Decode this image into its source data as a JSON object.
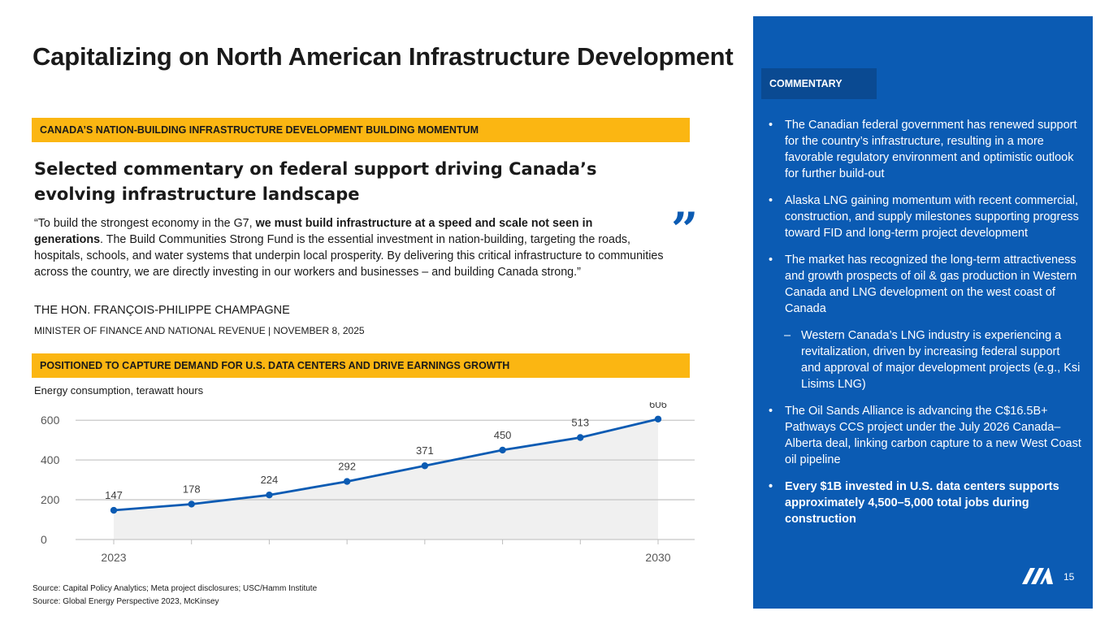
{
  "title": "Capitalizing on North American Infrastructure Development",
  "banner1": "CANADA’S NATION-BUILDING INFRASTRUCTURE DEVELOPMENT BUILDING MOMENTUM",
  "subhead": "Selected commentary on federal support driving Canada’s evolving infrastructure landscape",
  "quote": {
    "part1": "“To build the strongest economy in the G7, ",
    "bold": "we must build infrastructure at a speed and scale not seen in generations",
    "part2": ". The Build Communities Strong Fund is the essential investment in nation-building, targeting the roads, hospitals, schools, and water systems that underpin local prosperity. By delivering this critical infrastructure to communities across the country, we are directly investing in our workers and businesses – and building Canada strong.”",
    "mark": "”"
  },
  "speaker": "THE HON. FRANÇOIS-PHILIPPE CHAMPAGNE",
  "speaker_title": "MINISTER OF FINANCE AND NATIONAL REVENUE | NOVEMBER 8, 2025",
  "banner2": "POSITIONED TO CAPTURE DEMAND FOR U.S. DATA CENTERS AND DRIVE EARNINGS GROWTH",
  "chart_label": "Energy consumption, terawatt hours",
  "chart_data": {
    "type": "line",
    "x": [
      2023,
      2024,
      2025,
      2026,
      2027,
      2028,
      2029,
      2030
    ],
    "x_tick_labels": [
      "2023",
      "",
      "",
      "",
      "",
      "",
      "",
      "2030"
    ],
    "values": [
      147,
      178,
      224,
      292,
      371,
      450,
      513,
      606
    ],
    "data_labels": [
      "147",
      "178",
      "224",
      "292",
      "371",
      "450",
      "513",
      "606"
    ],
    "y_ticks": [
      "0",
      "200",
      "400",
      "600"
    ],
    "ylim": [
      0,
      650
    ],
    "grid": true,
    "area_fill": true,
    "line_color": "#0b5bb3",
    "fill_color": "#f0f0f0"
  },
  "sources": [
    "Source: Capital Policy Analytics; Meta project disclosures; USC/Hamm Institute",
    "Source: Global Energy Perspective 2023, McKinsey"
  ],
  "panel": {
    "tab": "COMMENTARY",
    "bullets": [
      {
        "text": "The Canadian federal government has renewed support for the country’s infrastructure, resulting in a more favorable regulatory environment and optimistic outlook for further build-out",
        "level": 1,
        "bold": false
      },
      {
        "text": "Alaska LNG gaining momentum with recent commercial, construction, and supply milestones supporting progress toward FID and long-term project development",
        "level": 1,
        "bold": false
      },
      {
        "text": "The market has recognized the long-term attractiveness and growth prospects of oil & gas production in Western Canada and LNG development on the west coast of Canada",
        "level": 1,
        "bold": false
      },
      {
        "text": "Western Canada’s LNG industry is experiencing a revitalization, driven by increasing federal support and approval of major development projects (e.g., Ksi Lisims LNG)",
        "level": 2,
        "bold": false
      },
      {
        "text": "The Oil Sands Alliance is advancing the C$16.5B+ Pathways CCS project under the July 2026 Canada–Alberta deal, linking carbon capture to a new West Coast oil pipeline",
        "level": 1,
        "bold": false
      },
      {
        "text": "Every $1B invested in U.S. data centers supports approximately 4,500–5,000 total jobs during construction",
        "level": 1,
        "bold": true
      }
    ],
    "bullet_glyph": "•",
    "sub_glyph": "–",
    "page_number": "15"
  },
  "colors": {
    "accent": "#0b5bb3",
    "banner": "#fbb612",
    "panel_tab": "#0a4a92"
  }
}
